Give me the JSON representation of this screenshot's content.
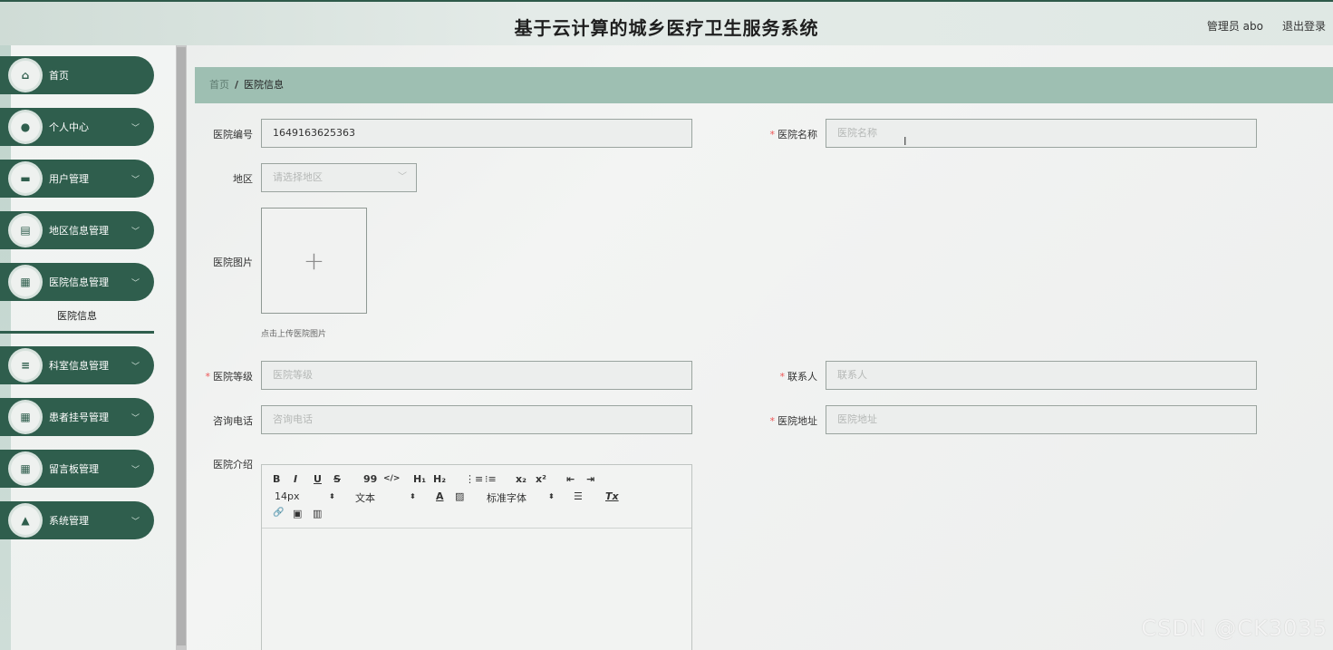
{
  "header": {
    "title": "基于云计算的城乡医疗卫生服务系统",
    "user": "管理员 abo",
    "logout": "退出登录"
  },
  "sidebar": {
    "items": [
      {
        "label": "首页",
        "icon": "home-icon",
        "glyph": "⌂",
        "chevron": false
      },
      {
        "label": "个人中心",
        "icon": "user-icon",
        "glyph": "●",
        "chevron": true
      },
      {
        "label": "用户管理",
        "icon": "briefcase-icon",
        "glyph": "▬",
        "chevron": true
      },
      {
        "label": "地区信息管理",
        "icon": "clipboard-icon",
        "glyph": "▤",
        "chevron": true
      },
      {
        "label": "医院信息管理",
        "icon": "grid-icon",
        "glyph": "▦",
        "chevron": true
      },
      {
        "label": "科室信息管理",
        "icon": "menu-icon",
        "glyph": "≡",
        "chevron": true
      },
      {
        "label": "患者挂号管理",
        "icon": "grid-icon",
        "glyph": "▦",
        "chevron": true
      },
      {
        "label": "留言板管理",
        "icon": "grid-icon",
        "glyph": "▦",
        "chevron": true
      },
      {
        "label": "系统管理",
        "icon": "person-icon",
        "glyph": "▲",
        "chevron": true
      }
    ],
    "sub_item": "医院信息",
    "chevron_glyph": "﹀"
  },
  "breadcrumb": {
    "home": "首页",
    "sep": "/",
    "current": "医院信息"
  },
  "form": {
    "hospital_no": {
      "label": "医院编号",
      "value": "1649163625363"
    },
    "hospital_name": {
      "label": "医院名称",
      "placeholder": "医院名称",
      "required": "*"
    },
    "region": {
      "label": "地区",
      "placeholder": "请选择地区",
      "arrow": "﹀"
    },
    "image": {
      "label": "医院图片",
      "plus": "+",
      "hint": "点击上传医院图片"
    },
    "level": {
      "label": "医院等级",
      "placeholder": "医院等级",
      "required": "*"
    },
    "contact": {
      "label": "联系人",
      "placeholder": "联系人",
      "required": "*"
    },
    "phone": {
      "label": "咨询电话",
      "placeholder": "咨询电话"
    },
    "address": {
      "label": "医院地址",
      "placeholder": "医院地址",
      "required": "*"
    },
    "intro": {
      "label": "医院介绍"
    }
  },
  "editor_toolbar": {
    "bold": "B",
    "italic": "I",
    "underline": "U",
    "strike": "S",
    "quote": "99",
    "code": "</>",
    "h1": "H₁",
    "h2": "H₂",
    "ordered_list": "⋮≡",
    "bullet_list": "⁝≡",
    "subscript": "x₂",
    "superscript": "x²",
    "outdent": "⇤",
    "indent": "⇥",
    "font_size": "14px",
    "font_size_caret": "⬍",
    "text_type": "文本",
    "text_type_caret": "⬍",
    "font_color": "A",
    "bg_color": "▨",
    "font_family": "标准字体",
    "font_family_caret": "⬍",
    "align": "☰",
    "clear": "Tx",
    "link": "🔗",
    "image": "▣",
    "video": "▥"
  },
  "cursor": "I",
  "watermark": "CSDN @CK3035"
}
